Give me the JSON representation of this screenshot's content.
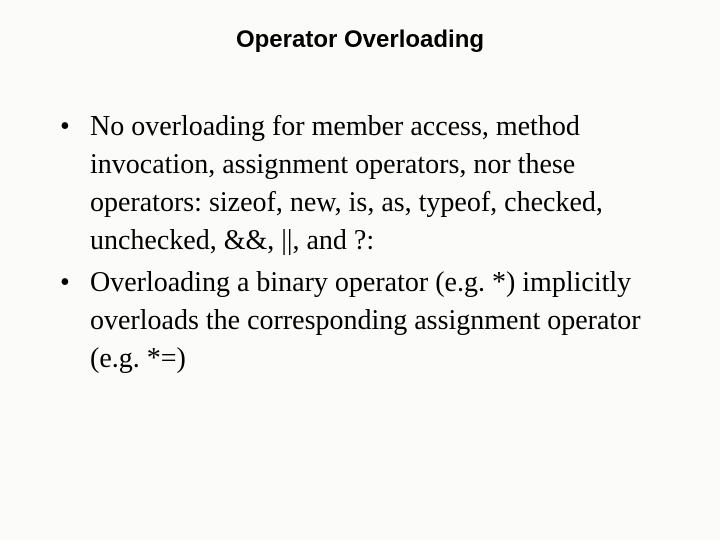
{
  "slide": {
    "title": "Operator Overloading",
    "bullets": [
      {
        "text": "No overloading for member access, method invocation, assignment operators, nor these operators: sizeof, new, is, as, typeof, checked, unchecked, &&, ||, and ?:"
      },
      {
        "text": "Overloading a binary operator (e.g. *) implicitly overloads the corresponding assignment operator (e.g. *=)"
      }
    ]
  }
}
